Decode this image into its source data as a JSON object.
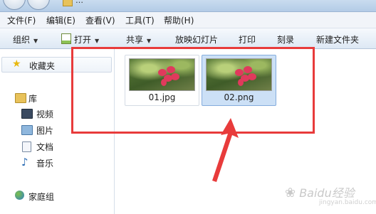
{
  "window": {
    "title": "…",
    "menu": [
      "文件(F)",
      "编辑(E)",
      "查看(V)",
      "工具(T)",
      "帮助(H)"
    ]
  },
  "toolbar": {
    "organize": "组织",
    "open": "打开",
    "share": "共享",
    "slideshow": "放映幻灯片",
    "print": "打印",
    "burn": "刻录",
    "new_folder": "新建文件夹"
  },
  "sidebar": {
    "favorites": "收藏夹",
    "library": "库",
    "items": [
      "视频",
      "图片",
      "文档",
      "音乐"
    ],
    "homegroup": "家庭组"
  },
  "files": [
    {
      "name": "01.jpg",
      "selected": false
    },
    {
      "name": "02.png",
      "selected": true
    }
  ],
  "watermark": {
    "text": "Baidu经验",
    "sub": "jingyan.baidu.com"
  },
  "colors": {
    "annotation": "#e83b3b",
    "selection": "#cce0f6"
  },
  "icons": [
    "star-icon",
    "library-icon",
    "video-icon",
    "picture-icon",
    "document-icon",
    "music-icon",
    "homegroup-icon",
    "open-icon"
  ]
}
